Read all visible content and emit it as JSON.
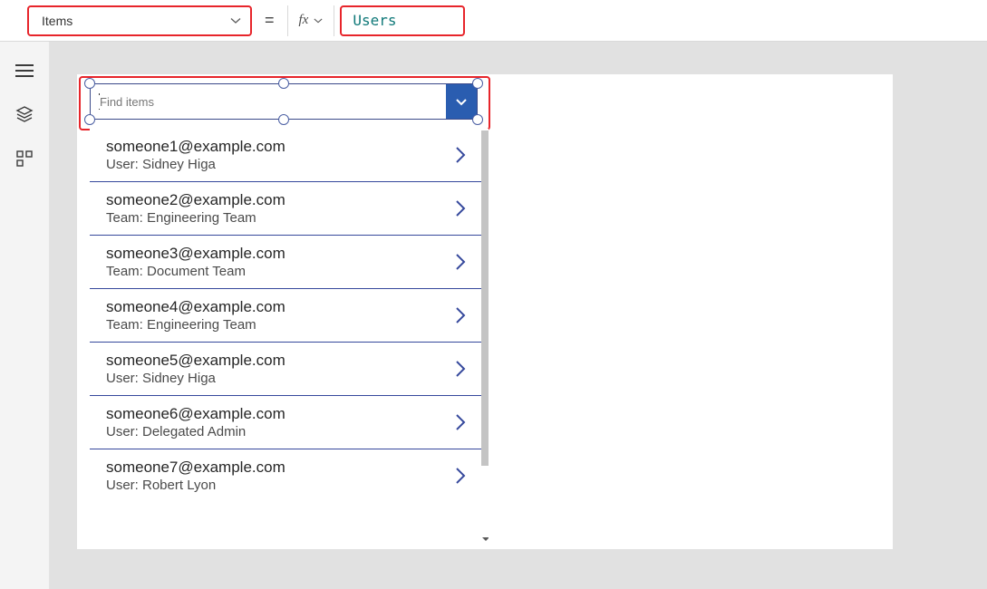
{
  "formula_bar": {
    "property_label": "Items",
    "equals": "=",
    "fx_label": "fx",
    "value": "Users"
  },
  "left_rail": {
    "items": [
      {
        "name": "tree-icon"
      },
      {
        "name": "layers-icon"
      },
      {
        "name": "components-icon"
      }
    ]
  },
  "combobox": {
    "placeholder": "Find items"
  },
  "gallery": {
    "rows": [
      {
        "primary": "someone1@example.com",
        "secondary": "User: Sidney Higa"
      },
      {
        "primary": "someone2@example.com",
        "secondary": "Team: Engineering Team"
      },
      {
        "primary": "someone3@example.com",
        "secondary": "Team: Document Team"
      },
      {
        "primary": "someone4@example.com",
        "secondary": "Team: Engineering Team"
      },
      {
        "primary": "someone5@example.com",
        "secondary": "User: Sidney Higa"
      },
      {
        "primary": "someone6@example.com",
        "secondary": "User: Delegated Admin"
      },
      {
        "primary": "someone7@example.com",
        "secondary": "User: Robert Lyon"
      }
    ]
  }
}
